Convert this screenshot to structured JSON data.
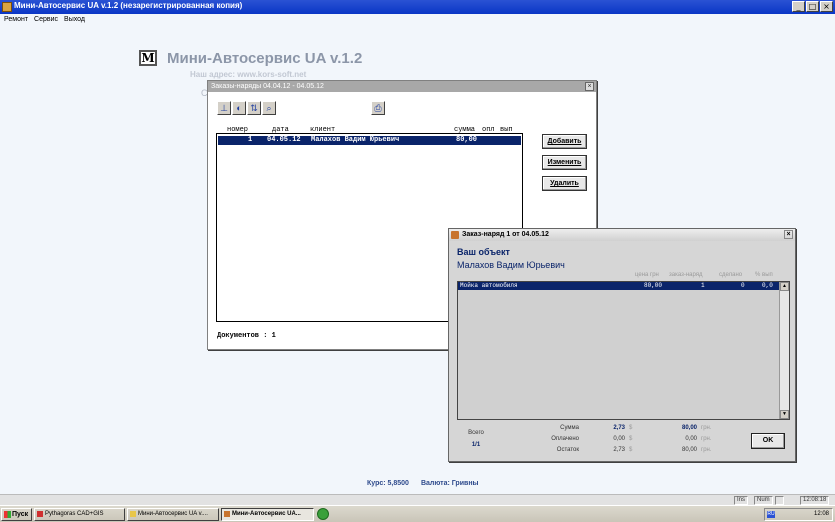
{
  "window": {
    "title": "Мини-Автосервис UA v.1.2 (незарегистрированная копия)",
    "min": "_",
    "max": "□",
    "close": "×"
  },
  "menu": [
    "Ремонт",
    "Сервис",
    "Выход"
  ],
  "background": {
    "logo_letter": "M",
    "heading": "Мини-Автосервис UA v.1.2",
    "address": "Наш адрес: www.kors-soft.net",
    "partial": "С",
    "rate": "Курс: 5,8500",
    "currency": "Валюта: Гривны"
  },
  "orders_window": {
    "title": "Заказы-наряды   04.04.12 - 04.05.12",
    "close": "×",
    "toolbar": {
      "tool1": "⊥",
      "tool2": "◐",
      "tool3": "⇅",
      "tool4": "⌕",
      "print": "⎙"
    },
    "columns": [
      "номер",
      "дата",
      "клиент",
      "сумма",
      "опл",
      "вып"
    ],
    "rows": [
      {
        "number": "1",
        "date": "04.05.12",
        "client": "Малахов Вадим Юрьевич",
        "sum": "80,00"
      }
    ],
    "buttons": {
      "add": "Добавить",
      "edit": "Изменить",
      "delete": "Удалить"
    },
    "docs_count": "Документов :  1"
  },
  "detail_window": {
    "title": "Заказ-наряд 1 от 04.05.12",
    "close": "×",
    "object_heading": "Ваш объект",
    "client": "Малахов Вадим Юрьевич",
    "columns": {
      "price": "цена грн",
      "order": "заказ-наряд",
      "done": "сделано",
      "percent": "% вып"
    },
    "items": [
      {
        "name": "Мойка автомобиля",
        "price": "80,00",
        "order": "1",
        "done": "0",
        "percent": "0,0"
      }
    ],
    "scroll_up": "▲",
    "scroll_down": "▼",
    "totals": {
      "total_label": "Всего",
      "total_value": "1/1",
      "sum_label": "Сумма",
      "paid_label": "Оплачено",
      "balance_label": "Остаток",
      "sum_usd": "2,73",
      "paid_usd": "0,00",
      "balance_usd": "2,73",
      "usd_symbol": "$",
      "sum_uah": "80,00",
      "paid_uah": "0,00",
      "balance_uah": "80,00",
      "uah_symbol": "грн."
    },
    "ok": "OK"
  },
  "statusbar": {
    "ins": "Ins",
    "num": "Num",
    "time": "12:08:18"
  },
  "taskbar": {
    "start": "Пуск",
    "tasks": [
      "Pythagoras CAD+GIS",
      "Мини-Автосервис UA v....",
      "Мини-Автосервис UA..."
    ],
    "tray_lang": "RU",
    "tray_time": "12:08"
  }
}
